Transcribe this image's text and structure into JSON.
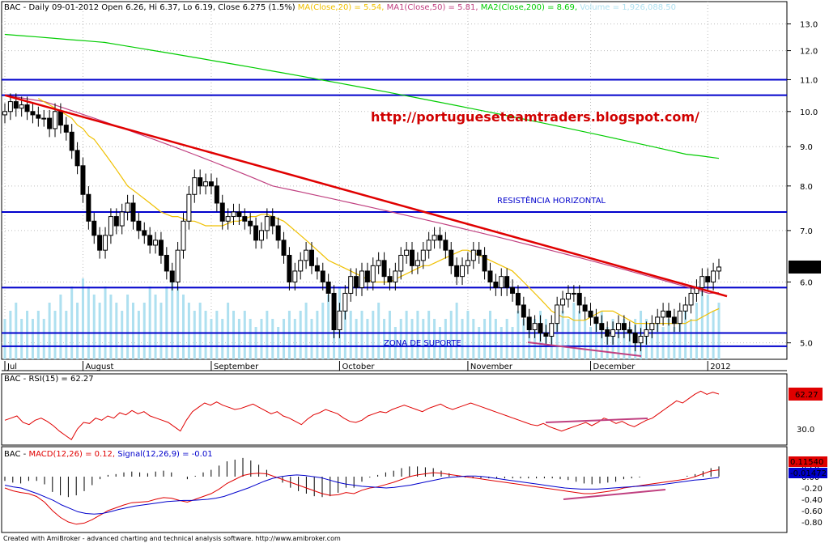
{
  "header": {
    "symbol": "BAC",
    "main_title": "BAC - Daily 09-01-2012 Open 6.26, Hi 6.37, Lo 6.19, Close 6.275 (1.5%)",
    "ma20": "MA(Close,20) = 5.54,",
    "ma50": "MA1(Close,50) = 5.81,",
    "ma200": "MA2(Close,200) = 8.69,",
    "volume": "Volume = 1,926,088.50",
    "rsi_title": "BAC - RSI(15) = 62.27",
    "macd_prefix": "BAC - ",
    "macd_title": "MACD(12,26) = 0.12,",
    "signal_title": "Signal(12,26,9) = -0.01",
    "footer": "Created with AmiBroker - advanced charting and technical analysis software. http://www.amibroker.com"
  },
  "annotations": {
    "url": "http://portugueseteamtraders.blogspot.com/",
    "resistance": "RESISTÊNCIA HORIZONTAL",
    "support": "ZONA DE SUPORTE"
  },
  "colors": {
    "candle": "#000000",
    "volume": "#aee0f0",
    "ma20": "#f0c000",
    "ma50": "#c04080",
    "ma200": "#00cc00",
    "trendline": "#e00000",
    "levels": "#0000cc",
    "rsi": "#e00000",
    "macd": "#e00000",
    "signal": "#0000cc"
  },
  "chart_data": [
    {
      "type": "candlestick",
      "panel": "price",
      "log_scale": true,
      "ylim": [
        4.9,
        13.5
      ],
      "y_ticks": [
        "13.0",
        "12.0",
        "11.0",
        "10.0",
        "9.0",
        "8.0",
        "7.0",
        "6.0",
        "5.0"
      ],
      "y_tick_values": [
        13,
        12,
        11,
        10,
        9,
        8,
        7,
        6,
        5
      ],
      "x_labels": [
        "Jul",
        "August",
        "September",
        "October",
        "November",
        "December",
        "2012"
      ],
      "x_label_index": [
        0,
        14,
        37,
        60,
        83,
        105,
        126
      ],
      "last_price_label": "6.275",
      "levels": [
        11.0,
        10.5,
        7.4,
        5.9,
        5.15,
        4.95
      ],
      "trendline": {
        "from": [
          0,
          10.5
        ],
        "to": [
          131,
          5.75
        ]
      },
      "volume_relative": [
        0.5,
        0.6,
        0.7,
        0.5,
        0.6,
        0.5,
        0.6,
        0.5,
        0.7,
        0.6,
        0.8,
        0.6,
        0.9,
        0.7,
        1.0,
        0.9,
        0.8,
        0.7,
        0.9,
        0.8,
        0.7,
        0.6,
        0.8,
        0.7,
        0.6,
        0.7,
        0.9,
        0.8,
        0.7,
        0.9,
        1.0,
        0.9,
        0.8,
        0.7,
        0.6,
        0.7,
        0.6,
        0.5,
        0.6,
        0.5,
        0.7,
        0.6,
        0.5,
        0.6,
        0.5,
        0.4,
        0.5,
        0.6,
        0.5,
        0.4,
        0.5,
        0.6,
        0.5,
        0.6,
        0.7,
        0.5,
        0.6,
        0.7,
        0.8,
        0.5,
        0.9,
        0.7,
        0.6,
        0.5,
        0.6,
        0.5,
        0.6,
        0.7,
        0.5,
        0.6,
        0.4,
        0.5,
        0.6,
        0.5,
        0.6,
        0.5,
        0.6,
        0.5,
        0.4,
        0.5,
        0.6,
        0.7,
        0.5,
        0.6,
        0.5,
        0.4,
        0.5,
        0.6,
        0.5,
        0.4,
        0.5,
        0.4,
        0.6,
        0.5,
        0.4,
        0.5,
        0.6,
        0.5,
        0.4,
        0.5,
        0.6,
        0.5,
        0.7,
        0.6,
        0.5,
        0.4,
        0.5,
        0.6,
        0.4,
        0.5,
        0.4,
        0.5,
        0.4,
        0.5,
        0.6,
        0.5,
        0.4,
        0.5,
        0.4,
        0.5,
        0.4,
        0.5,
        0.6,
        0.5,
        0.7,
        0.9,
        0.8,
        0.6,
        0.7,
        0.6,
        0.5,
        0.6
      ],
      "close": [
        10.0,
        10.3,
        10.1,
        10.2,
        10.0,
        9.9,
        9.8,
        9.8,
        9.5,
        10.0,
        9.6,
        9.4,
        8.9,
        8.5,
        7.8,
        7.2,
        6.9,
        6.6,
        6.9,
        7.3,
        7.1,
        7.4,
        7.6,
        7.2,
        7.0,
        6.9,
        6.7,
        6.8,
        6.5,
        6.2,
        6.0,
        6.6,
        7.2,
        7.8,
        8.2,
        8.0,
        8.1,
        8.0,
        7.6,
        7.2,
        7.3,
        7.4,
        7.3,
        7.2,
        7.1,
        6.8,
        7.0,
        7.3,
        7.1,
        6.8,
        6.5,
        6.0,
        6.2,
        6.4,
        6.6,
        6.3,
        6.2,
        6.0,
        5.8,
        5.2,
        5.5,
        5.8,
        6.1,
        5.9,
        6.2,
        6.0,
        6.3,
        6.4,
        6.1,
        6.0,
        6.2,
        6.5,
        6.6,
        6.3,
        6.4,
        6.6,
        6.8,
        6.9,
        6.8,
        6.6,
        6.3,
        6.1,
        6.3,
        6.4,
        6.6,
        6.5,
        6.2,
        6.0,
        5.9,
        6.1,
        5.9,
        5.8,
        5.6,
        5.4,
        5.2,
        5.3,
        5.15,
        5.1,
        5.3,
        5.6,
        5.7,
        5.8,
        5.8,
        5.6,
        5.5,
        5.4,
        5.3,
        5.2,
        5.1,
        5.2,
        5.3,
        5.2,
        5.15,
        5.0,
        5.1,
        5.2,
        5.3,
        5.4,
        5.5,
        5.4,
        5.3,
        5.5,
        5.6,
        5.8,
        5.9,
        6.1,
        6.0,
        6.2,
        6.275
      ],
      "ma20": [
        10.4,
        10.3,
        10.2,
        10.1,
        10.0,
        9.9,
        9.8,
        9.6,
        9.5,
        9.3,
        9.2,
        9.0,
        8.8,
        8.6,
        8.4,
        8.2,
        8.0,
        7.9,
        7.8,
        7.7,
        7.6,
        7.5,
        7.4,
        7.35,
        7.3,
        7.3,
        7.25,
        7.2,
        7.2,
        7.15,
        7.1,
        7.1,
        7.1,
        7.1,
        7.15,
        7.2,
        7.2,
        7.25,
        7.3,
        7.3,
        7.35,
        7.35,
        7.3,
        7.25,
        7.2,
        7.1,
        7.0,
        6.9,
        6.8,
        6.7,
        6.6,
        6.5,
        6.4,
        6.35,
        6.3,
        6.25,
        6.2,
        6.15,
        6.1,
        6.05,
        6.0,
        6.0,
        6.0,
        6.0,
        6.05,
        6.1,
        6.15,
        6.2,
        6.25,
        6.3,
        6.3,
        6.35,
        6.4,
        6.45,
        6.5,
        6.55,
        6.6,
        6.6,
        6.55,
        6.5,
        6.45,
        6.4,
        6.35,
        6.3,
        6.25,
        6.2,
        6.1,
        6.0,
        5.9,
        5.8,
        5.7,
        5.6,
        5.5,
        5.45,
        5.4,
        5.4,
        5.35,
        5.35,
        5.35,
        5.4,
        5.45,
        5.5,
        5.5,
        5.5,
        5.45,
        5.4,
        5.35,
        5.3,
        5.3,
        5.3,
        5.3,
        5.3,
        5.3,
        5.3,
        5.3,
        5.3,
        5.3,
        5.35,
        5.35,
        5.4,
        5.45,
        5.5,
        5.54
      ],
      "ma50": [
        10.5,
        10.45,
        10.4,
        10.35,
        10.3,
        10.2,
        10.1,
        10.0,
        9.9,
        9.8,
        9.7,
        9.6,
        9.5,
        9.4,
        9.3,
        9.2,
        9.1,
        9.0,
        8.9,
        8.8,
        8.7,
        8.6,
        8.5,
        8.4,
        8.3,
        8.2,
        8.1,
        8.0,
        7.95,
        7.9,
        7.85,
        7.8,
        7.75,
        7.7,
        7.65,
        7.6,
        7.55,
        7.5,
        7.45,
        7.4,
        7.35,
        7.3,
        7.25,
        7.2,
        7.15,
        7.1,
        7.05,
        7.0,
        6.95,
        6.9,
        6.85,
        6.8,
        6.75,
        6.7,
        6.65,
        6.6,
        6.55,
        6.5,
        6.45,
        6.4,
        6.35,
        6.3,
        6.25,
        6.2,
        6.15,
        6.1,
        6.05,
        6.0,
        5.95,
        5.9,
        5.85,
        5.8,
        5.81
      ],
      "ma200": [
        12.6,
        12.55,
        12.5,
        12.45,
        12.4,
        12.35,
        12.3,
        12.2,
        12.1,
        12.0,
        11.9,
        11.8,
        11.7,
        11.6,
        11.5,
        11.4,
        11.3,
        11.2,
        11.1,
        11.0,
        10.9,
        10.8,
        10.7,
        10.6,
        10.5,
        10.4,
        10.3,
        10.2,
        10.1,
        10.0,
        9.9,
        9.8,
        9.7,
        9.6,
        9.5,
        9.4,
        9.3,
        9.2,
        9.1,
        9.0,
        8.9,
        8.8,
        8.75,
        8.69
      ]
    },
    {
      "type": "line",
      "panel": "rsi",
      "title": "RSI(15)",
      "y_ticks": [
        "30.0"
      ],
      "y_tick_values": [
        30
      ],
      "ylim": [
        18,
        72
      ],
      "last_value_label": "62.27",
      "values": [
        38,
        40,
        42,
        36,
        34,
        38,
        40,
        37,
        33,
        28,
        24,
        20,
        30,
        36,
        35,
        40,
        38,
        42,
        40,
        45,
        43,
        47,
        44,
        46,
        42,
        40,
        38,
        36,
        32,
        28,
        38,
        46,
        50,
        54,
        52,
        55,
        52,
        50,
        48,
        49,
        51,
        53,
        50,
        47,
        44,
        46,
        42,
        40,
        37,
        34,
        39,
        43,
        45,
        48,
        46,
        44,
        40,
        37,
        36,
        38,
        42,
        44,
        46,
        45,
        48,
        50,
        52,
        50,
        48,
        46,
        49,
        51,
        53,
        50,
        48,
        50,
        52,
        54,
        52,
        50,
        48,
        46,
        44,
        42,
        40,
        38,
        36,
        34,
        33,
        35,
        32,
        30,
        28,
        30,
        32,
        34,
        36,
        33,
        36,
        40,
        38,
        35,
        37,
        34,
        32,
        35,
        38,
        40,
        44,
        48,
        52,
        56,
        54,
        58,
        62,
        65,
        62,
        64,
        62.27
      ]
    },
    {
      "type": "line",
      "panel": "macd",
      "y_ticks": [
        "0.20",
        "0.00",
        "-0.20",
        "-0.40",
        "-0.60",
        "-0.80"
      ],
      "y_tick_values": [
        0.2,
        0.0,
        -0.2,
        -0.4,
        -0.6,
        -0.8
      ],
      "ylim": [
        -0.9,
        0.3
      ],
      "value_labels": [
        "0.11540",
        "-0.01472"
      ],
      "series": [
        {
          "name": "MACD(12,26)",
          "values": [
            -0.2,
            -0.25,
            -0.28,
            -0.3,
            -0.35,
            -0.45,
            -0.6,
            -0.72,
            -0.8,
            -0.84,
            -0.82,
            -0.76,
            -0.68,
            -0.6,
            -0.55,
            -0.5,
            -0.46,
            -0.45,
            -0.44,
            -0.4,
            -0.37,
            -0.38,
            -0.42,
            -0.45,
            -0.4,
            -0.35,
            -0.3,
            -0.22,
            -0.12,
            -0.05,
            0.02,
            0.05,
            0.06,
            0.05,
            0.0,
            -0.05,
            -0.1,
            -0.15,
            -0.2,
            -0.25,
            -0.3,
            -0.33,
            -0.32,
            -0.28,
            -0.3,
            -0.24,
            -0.2,
            -0.18,
            -0.14,
            -0.1,
            -0.05,
            0.0,
            0.03,
            0.05,
            0.07,
            0.06,
            0.04,
            0.02,
            0.0,
            -0.02,
            -0.04,
            -0.06,
            -0.08,
            -0.1,
            -0.12,
            -0.14,
            -0.16,
            -0.18,
            -0.2,
            -0.22,
            -0.24,
            -0.26,
            -0.28,
            -0.3,
            -0.3,
            -0.28,
            -0.26,
            -0.24,
            -0.2,
            -0.18,
            -0.16,
            -0.14,
            -0.12,
            -0.1,
            -0.08,
            -0.06,
            -0.04,
            0.0,
            0.05,
            0.1,
            0.12
          ]
        },
        {
          "name": "Signal(12,26,9)",
          "values": [
            -0.15,
            -0.18,
            -0.2,
            -0.25,
            -0.3,
            -0.36,
            -0.42,
            -0.5,
            -0.56,
            -0.62,
            -0.65,
            -0.66,
            -0.65,
            -0.62,
            -0.58,
            -0.55,
            -0.52,
            -0.5,
            -0.48,
            -0.46,
            -0.44,
            -0.43,
            -0.42,
            -0.42,
            -0.41,
            -0.4,
            -0.38,
            -0.35,
            -0.3,
            -0.25,
            -0.2,
            -0.14,
            -0.08,
            -0.03,
            0.0,
            0.02,
            0.03,
            0.02,
            0.0,
            -0.02,
            -0.06,
            -0.1,
            -0.13,
            -0.15,
            -0.17,
            -0.18,
            -0.19,
            -0.2,
            -0.19,
            -0.17,
            -0.15,
            -0.12,
            -0.09,
            -0.06,
            -0.03,
            -0.01,
            0.0,
            0.01,
            0.01,
            0.0,
            -0.02,
            -0.04,
            -0.06,
            -0.08,
            -0.1,
            -0.12,
            -0.14,
            -0.16,
            -0.18,
            -0.2,
            -0.21,
            -0.22,
            -0.22,
            -0.22,
            -0.21,
            -0.2,
            -0.19,
            -0.18,
            -0.17,
            -0.16,
            -0.15,
            -0.14,
            -0.12,
            -0.1,
            -0.08,
            -0.06,
            -0.05,
            -0.03,
            -0.015
          ]
        }
      ]
    }
  ]
}
